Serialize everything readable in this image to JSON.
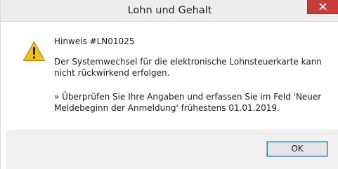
{
  "window": {
    "title": "Lohn und Gehalt",
    "close_icon": "close-icon"
  },
  "message": {
    "icon": "warning-icon",
    "title": "Hinweis #LN01025",
    "body": "Der Systemwechsel für die elektronische Lohnsteuerkarte kann nicht rückwirkend erfolgen.",
    "hint": "» Überprüfen Sie Ihre Angaben und erfassen Sie im Feld 'Neuer Meldebeginn der Anmeldung' frühestens 01.01.2019."
  },
  "buttons": {
    "ok_label": "OK"
  },
  "colors": {
    "close_button": "#c83c3c",
    "warning_fill": "#f2c21b",
    "footer": "#f0f0f0"
  }
}
